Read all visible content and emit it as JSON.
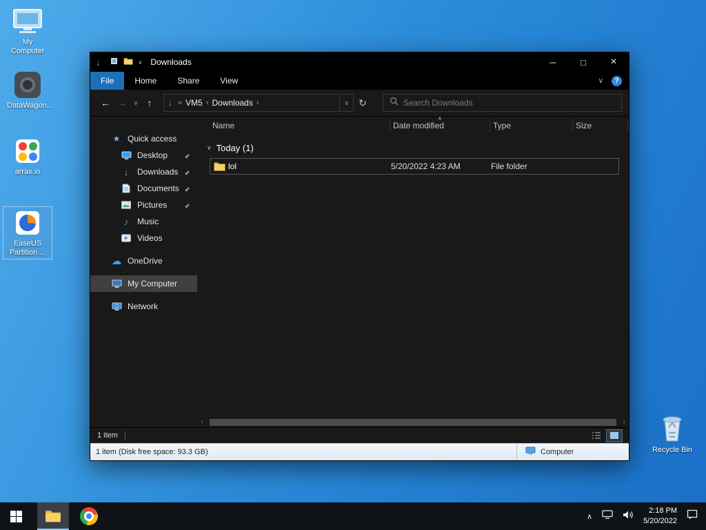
{
  "desktop": {
    "icons": [
      {
        "label": "My Computer"
      },
      {
        "label": "DataWagon..."
      },
      {
        "label": "arrax.io"
      },
      {
        "label": "EaseUS Partition ..."
      },
      {
        "label": "Recycle Bin"
      }
    ]
  },
  "window": {
    "title": "Downloads"
  },
  "glyphs": {
    "window_icon": "↓",
    "qat_chevron": "∨",
    "minimize": "─",
    "maximize": "□",
    "close": "×",
    "ribbon_chevron": "∨",
    "help": "?",
    "back": "←",
    "forward": "→",
    "nav_chevron": "∨",
    "up": "↑",
    "address_icon": "↓",
    "address_prefix": "«",
    "crumb_sep": "›",
    "address_chevron": "∨",
    "refresh": "↻",
    "star": "★",
    "downloads_arrow": "↓",
    "music_note": "♪",
    "cloud": "☁",
    "sort_caret": "∧",
    "group_chevron": "∨",
    "scroll_left": "‹",
    "scroll_right": "›",
    "tray_chevron": "∧"
  },
  "ribbon": {
    "tabs": [
      {
        "label": "File"
      },
      {
        "label": "Home"
      },
      {
        "label": "Share"
      },
      {
        "label": "View"
      }
    ]
  },
  "navbar": {
    "address": {
      "prefix": "«",
      "crumbs": [
        "VM5",
        "Downloads"
      ]
    },
    "search_placeholder": "Search Downloads"
  },
  "sidebar": {
    "items": [
      {
        "label": "Quick access"
      },
      {
        "label": "Desktop"
      },
      {
        "label": "Downloads"
      },
      {
        "label": "Documents"
      },
      {
        "label": "Pictures"
      },
      {
        "label": "Music"
      },
      {
        "label": "Videos"
      },
      {
        "label": "OneDrive"
      },
      {
        "label": "My Computer"
      },
      {
        "label": "Network"
      }
    ]
  },
  "filelist": {
    "columns": [
      "Name",
      "Date modified",
      "Type",
      "Size"
    ],
    "group": {
      "label": "Today (1)"
    },
    "rows": [
      {
        "name": "lol",
        "date_modified": "5/20/2022 4:23 AM",
        "type": "File folder",
        "size": ""
      }
    ]
  },
  "statusbar": {
    "items_count": "1 item"
  },
  "bottombar": {
    "left": "1 item (Disk free space: 93.3 GB)",
    "right": "Computer"
  },
  "taskbar": {
    "clock": {
      "time": "2:18 PM",
      "date": "5/20/2022"
    }
  }
}
